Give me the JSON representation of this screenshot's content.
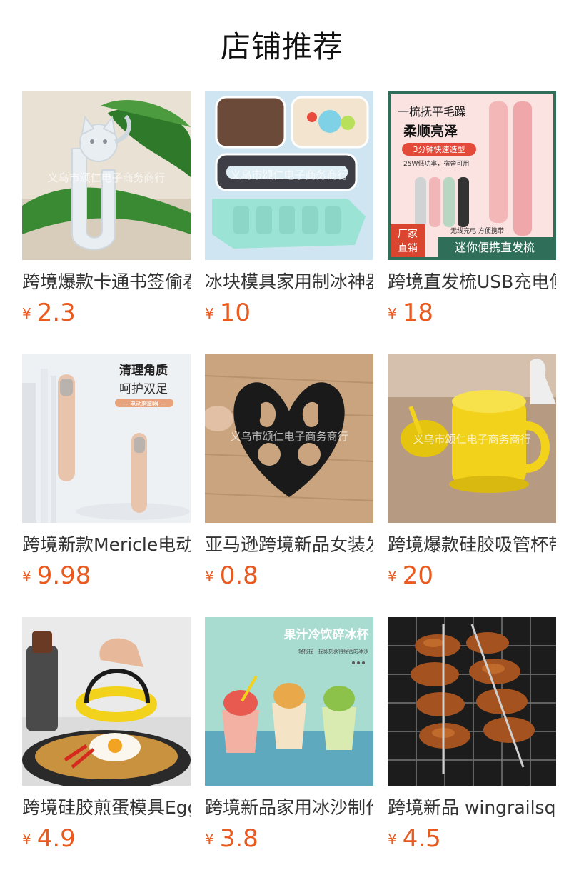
{
  "header": {
    "title": "店铺推荐"
  },
  "currency_symbol": "¥",
  "products": [
    {
      "name": "跨境爆款卡通书签偷看书签创意",
      "price": "2.3",
      "image": {
        "icon": "cat-bookmark-icon",
        "watermark": "义乌市颂仁电子商务商行"
      }
    },
    {
      "name": "冰块模具家用制冰神器",
      "price": "10",
      "image": {
        "icon": "ice-mold-icon",
        "watermark": "义乌市颂仁电子商务商行"
      }
    },
    {
      "name": "跨境直发梳USB充电便携",
      "price": "18",
      "image": {
        "icon": "hair-straightener-icon",
        "texts": [
          "一梳抚平毛躁",
          "柔顺亮泽",
          "3分钟快速造型",
          "25W低功率，宿舍可用",
          "无线充电 方便携带",
          "厂家",
          "直销",
          "迷你便携直发梳"
        ]
      }
    },
    {
      "name": "跨境新款Mericle电动磨脚器",
      "price": "9.98",
      "image": {
        "icon": "foot-file-icon",
        "texts": [
          "清理角质",
          "呵护双足",
          "— 电动磨脚器 —"
        ]
      }
    },
    {
      "name": "亚马逊跨境新品女装发夹",
      "price": "0.8",
      "image": {
        "icon": "hair-clip-icon",
        "watermark": "义乌市颂仁电子商务商行"
      }
    },
    {
      "name": "跨境爆款硅胶吸管杯带盖",
      "price": "20",
      "image": {
        "icon": "straw-cup-icon",
        "watermark": "义乌市颂仁电子商务商行"
      }
    },
    {
      "name": "跨境硅胶煎蛋模具Egg Ring",
      "price": "4.9",
      "image": {
        "icon": "egg-ring-icon"
      }
    },
    {
      "name": "跨境新品家用冰沙制作杯",
      "price": "3.8",
      "image": {
        "icon": "slushy-cup-icon",
        "texts": [
          "果汁冷饮碎冰杯",
          "轻松捏一捏即刻获得绵密的冰沙"
        ]
      }
    },
    {
      "name": "跨境新品 wingrailsq烤肉架",
      "price": "4.5",
      "image": {
        "icon": "bbq-wing-rack-icon"
      }
    }
  ]
}
